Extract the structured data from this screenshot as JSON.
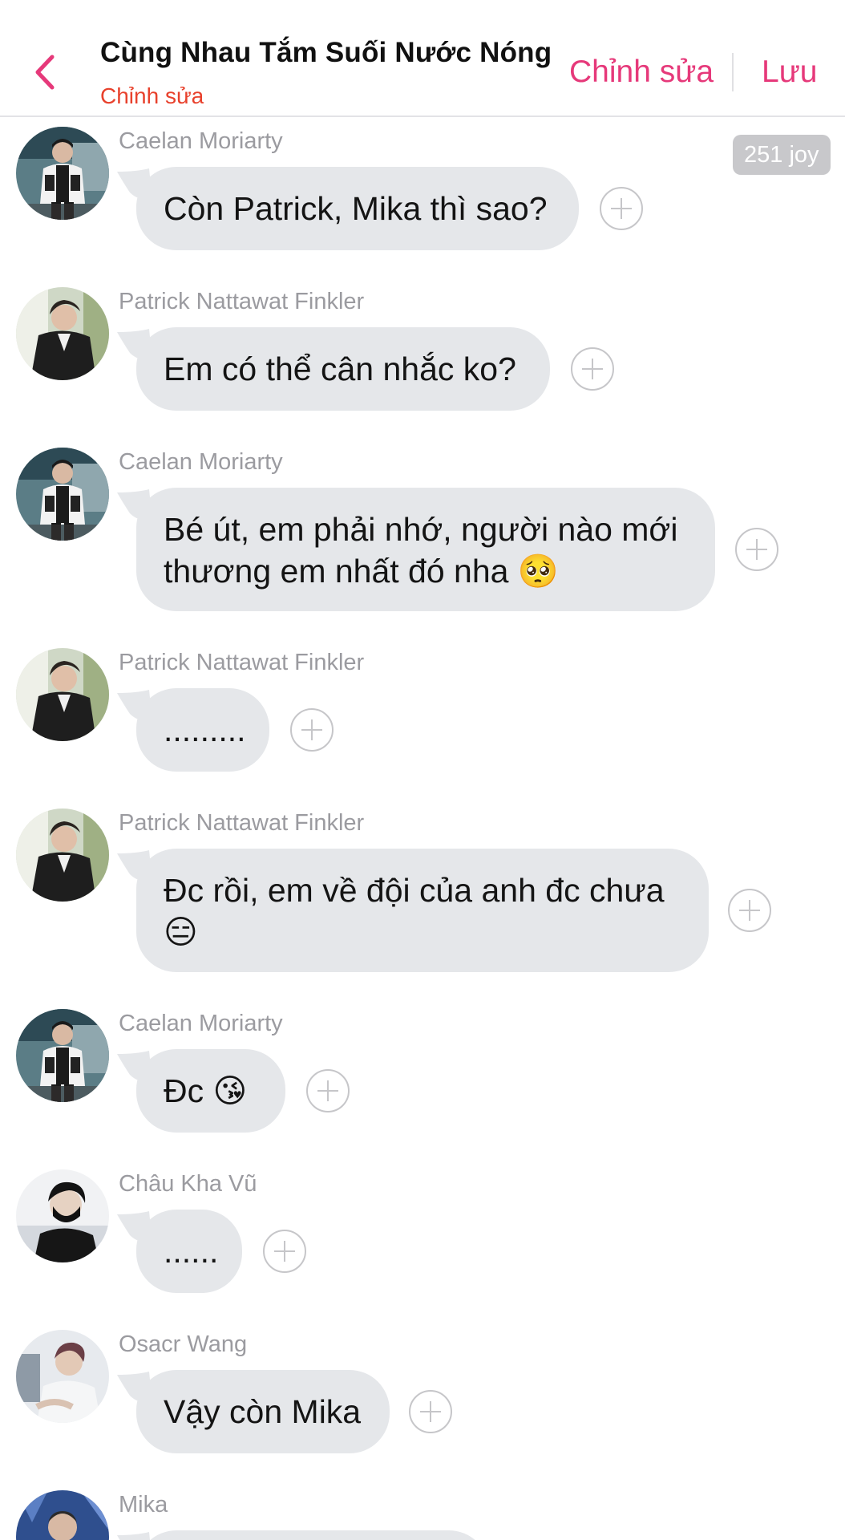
{
  "header": {
    "title": "Cùng Nhau Tắm Suối Nước Nóng",
    "subtitle": "Chỉnh sửa",
    "edit_label": "Chỉnh sửa",
    "save_label": "Lưu",
    "back_icon": "chevron-left-icon",
    "accent_color": "#e6397a",
    "subtitle_color": "#e8412c"
  },
  "joy_badge": "251 joy",
  "messages": [
    {
      "sender": "Caelan Moriarty",
      "line1": "Còn Patrick, Mika thì sao?",
      "avatar": "caelan"
    },
    {
      "sender": "Patrick Nattawat Finkler",
      "line1": "Em có thể cân nhắc ko?",
      "avatar": "patrick"
    },
    {
      "sender": "Caelan Moriarty",
      "line1": "Bé út, em phải nhớ, người nào mới",
      "line2": "thương em nhất đó nha 🥺",
      "avatar": "caelan"
    },
    {
      "sender": "Patrick Nattawat Finkler",
      "line1": ".........",
      "avatar": "patrick"
    },
    {
      "sender": "Patrick Nattawat Finkler",
      "line1": "Đc rồi, em về đội của anh đc chưa",
      "line2": "😑",
      "avatar": "patrick"
    },
    {
      "sender": "Caelan Moriarty",
      "line1": "Đc 😘",
      "avatar": "caelan"
    },
    {
      "sender": "Châu Kha Vũ",
      "line1": "......",
      "avatar": "chau"
    },
    {
      "sender": "Osacr Wang",
      "line1": "Vậy còn Mika",
      "avatar": "oscar"
    },
    {
      "sender": "Mika",
      "line1": "",
      "avatar": "mika"
    }
  ]
}
